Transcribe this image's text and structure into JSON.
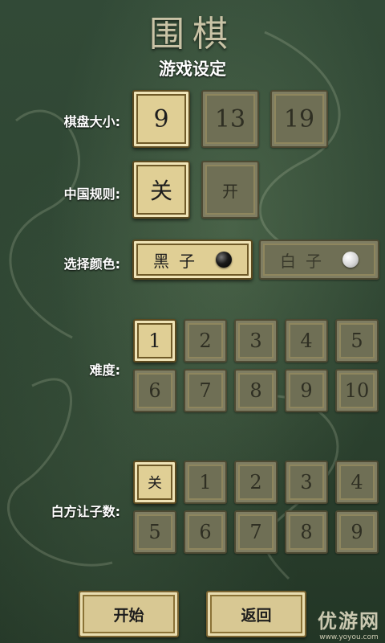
{
  "title": "围棋",
  "subtitle": "游戏设定",
  "board_size": {
    "label": "棋盘大小:",
    "options": [
      "9",
      "13",
      "19"
    ],
    "selected": "9"
  },
  "chinese_rules": {
    "label": "中国规则:",
    "options": [
      "关",
      "开"
    ],
    "selected": "关"
  },
  "color": {
    "label": "选择颜色:",
    "options": [
      {
        "text": "黑子",
        "stone": "black-stone-icon"
      },
      {
        "text": "白子",
        "stone": "white-stone-icon"
      }
    ],
    "selected": "黑子"
  },
  "difficulty": {
    "label": "难度:",
    "options": [
      "1",
      "2",
      "3",
      "4",
      "5",
      "6",
      "7",
      "8",
      "9",
      "10"
    ],
    "selected": "1"
  },
  "handicap": {
    "label": "白方让子数:",
    "options": [
      "关",
      "1",
      "2",
      "3",
      "4",
      "5",
      "6",
      "7",
      "8",
      "9"
    ],
    "selected": "关"
  },
  "buttons": {
    "start": "开始",
    "back": "返回"
  },
  "watermark": {
    "main": "优游网",
    "sub": "www.yoyou.com"
  },
  "colors": {
    "tile_on": "#d8c893",
    "tile_off": "#6f6f55",
    "bg": "#2f4633"
  }
}
